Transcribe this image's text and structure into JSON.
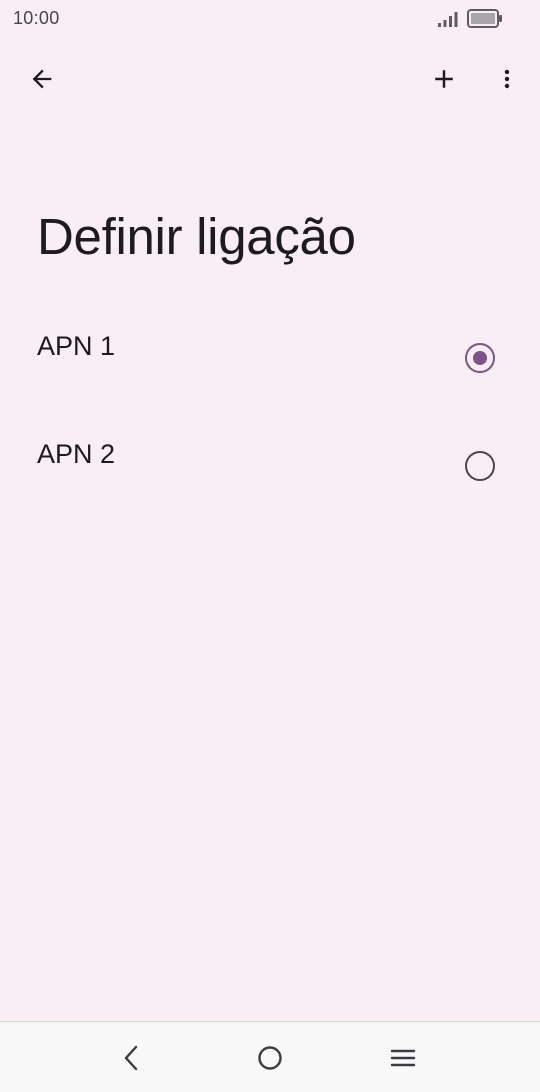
{
  "status_bar": {
    "time": "10:00"
  },
  "app_bar": {
    "back_icon": "arrow-back-icon",
    "add_icon": "plus-icon",
    "more_icon": "more-vert-icon"
  },
  "title": "Definir ligação",
  "apn_list": [
    {
      "label": "APN 1",
      "selected": true
    },
    {
      "label": "APN 2",
      "selected": false
    }
  ],
  "nav_bar": {
    "back_icon": "nav-back-icon",
    "home_icon": "nav-home-icon",
    "recents_icon": "nav-menu-icon"
  },
  "colors": {
    "background": "#f9eef4",
    "accent": "#7d5289",
    "text": "#1d1b20"
  }
}
